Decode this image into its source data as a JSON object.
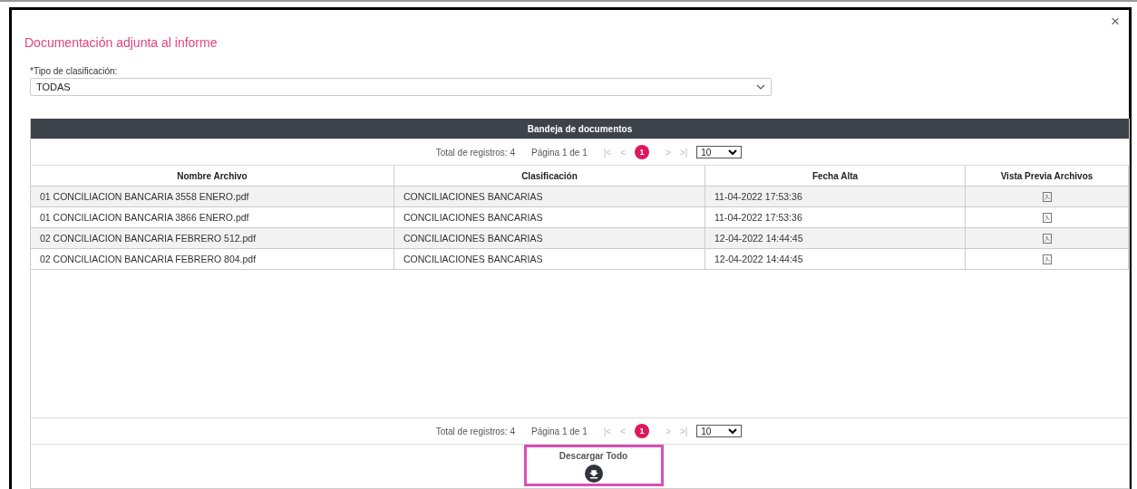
{
  "dialog": {
    "title": "Documentación adjunta al informe",
    "close": "×"
  },
  "filter": {
    "label": "*Tipo de clasificación:",
    "value": "TODAS"
  },
  "table": {
    "title": "Bandeja de documentos",
    "pagination_top": {
      "total": "Total de registros: 4",
      "page_info": "Página 1 de 1",
      "first": "|<",
      "prev": "<",
      "pages": [
        {
          "label": "1",
          "selected": true
        }
      ],
      "next": ">",
      "last": ">|",
      "per_page": "10"
    },
    "columns": [
      "Nombre Archivo",
      "Clasificación",
      "Fecha Alta",
      "Vista Previa Archivos"
    ],
    "rows": [
      {
        "name": "01 CONCILIACION BANCARIA 3558 ENERO.pdf",
        "classification": "CONCILIACIONES BANCARIAS",
        "date": "11-04-2022 17:53:36"
      },
      {
        "name": "01 CONCILIACION BANCARIA 3866 ENERO.pdf",
        "classification": "CONCILIACIONES BANCARIAS",
        "date": "11-04-2022 17:53:36"
      },
      {
        "name": "02 CONCILIACION BANCARIA FEBRERO 512.pdf",
        "classification": "CONCILIACIONES BANCARIAS",
        "date": "12-04-2022 14:44:45"
      },
      {
        "name": "02 CONCILIACION BANCARIA FEBRERO 804.pdf",
        "classification": "CONCILIACIONES BANCARIAS",
        "date": "12-04-2022 14:44:45"
      }
    ],
    "pagination_bottom": {
      "total": "Total de registros: 4",
      "page_info": "Página 1 de 1",
      "first": "|<",
      "prev": "<",
      "pages": [
        {
          "label": "1",
          "selected": true
        }
      ],
      "next": ">",
      "last": ">|",
      "per_page": "10"
    },
    "download_all": {
      "label": "Descargar Todo",
      "highlighted": true
    }
  }
}
